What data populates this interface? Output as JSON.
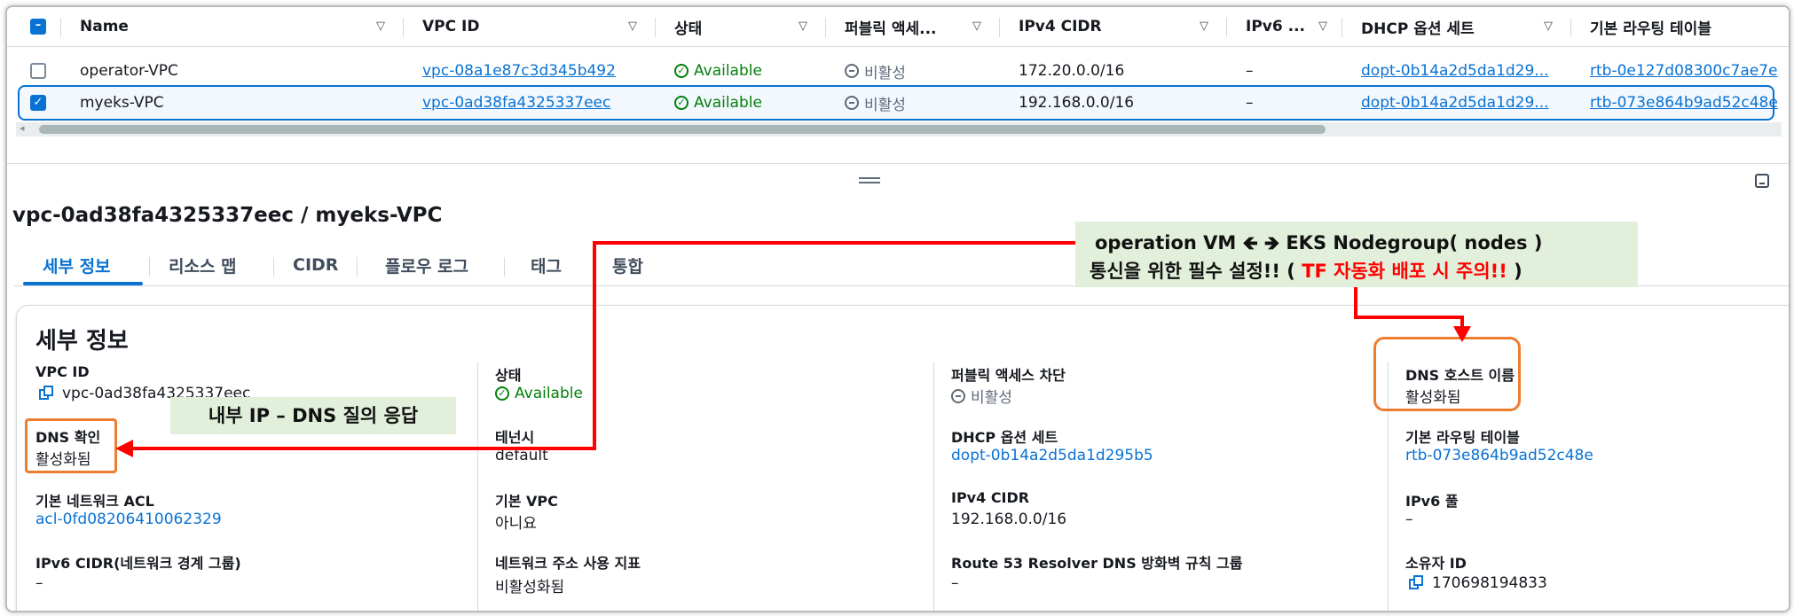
{
  "table": {
    "headers": [
      "Name",
      "VPC ID",
      "상태",
      "퍼블릭 액세...",
      "IPv4 CIDR",
      "IPv6 ...",
      "DHCP 옵션 세트",
      "기본 라우팅 테이블"
    ],
    "rows": [
      {
        "selected": false,
        "name": "operator-VPC",
        "vpc_id": "vpc-08a1e87c3d345b492",
        "status": "Available",
        "public": "비활성",
        "ipv4": "172.20.0.0/16",
        "ipv6": "–",
        "dhcp": "dopt-0b14a2d5da1d29...",
        "rtb": "rtb-0e127d08300c7ae7e"
      },
      {
        "selected": true,
        "name": "myeks-VPC",
        "vpc_id": "vpc-0ad38fa4325337eec",
        "status": "Available",
        "public": "비활성",
        "ipv4": "192.168.0.0/16",
        "ipv6": "–",
        "dhcp": "dopt-0b14a2d5da1d29...",
        "rtb": "rtb-073e864b9ad52c48e"
      }
    ]
  },
  "detail": {
    "title": "vpc-0ad38fa4325337eec / myeks-VPC",
    "tabs": [
      "세부 정보",
      "리소스 맵",
      "CIDR",
      "플로우 로그",
      "태그",
      "통합"
    ],
    "section_title": "세부 정보",
    "fields": {
      "vpc_id": {
        "label": "VPC ID",
        "value": "vpc-0ad38fa4325337eec"
      },
      "dns_resolution": {
        "label": "DNS 확인",
        "value": "활성화됨"
      },
      "main_acl": {
        "label": "기본 네트워크 ACL",
        "value": "acl-0fd08206410062329"
      },
      "ipv6_cidr": {
        "label": "IPv6 CIDR(네트워크 경계 그룹)",
        "value": "–"
      },
      "state": {
        "label": "상태",
        "value": "Available"
      },
      "tenancy": {
        "label": "테넌시",
        "value": "default"
      },
      "default_vpc": {
        "label": "기본 VPC",
        "value": "아니요"
      },
      "addr_metrics": {
        "label": "네트워크 주소 사용 지표",
        "value": "비활성화됨"
      },
      "block_public": {
        "label": "퍼블릭 액세스 차단",
        "value": "비활성"
      },
      "dhcp": {
        "label": "DHCP 옵션 세트",
        "value": "dopt-0b14a2d5da1d295b5"
      },
      "ipv4": {
        "label": "IPv4 CIDR",
        "value": "192.168.0.0/16"
      },
      "r53": {
        "label": "Route 53 Resolver DNS 방화벽 규칙 그룹",
        "value": "–"
      },
      "dns_hostnames": {
        "label": "DNS 호스트 이름",
        "value": "활성화됨"
      },
      "main_rtb": {
        "label": "기본 라우팅 테이블",
        "value": "rtb-073e864b9ad52c48e"
      },
      "ipv6_pool": {
        "label": "IPv6 풀",
        "value": "–"
      },
      "owner": {
        "label": "소유자 ID",
        "value": "170698194833"
      }
    }
  },
  "annotations": {
    "note1_line1": "operation VM 🡸 🡺 EKS Nodegroup( nodes )",
    "note1_line2_a": "통신을 위한 필수 설정!! ( ",
    "note1_line2_b": "TF 자동화 배포 시 주의!!",
    "note1_line2_c": " )",
    "note2": "내부 IP – DNS 질의 응답"
  },
  "colors": {
    "accent": "#0972d3",
    "success": "#037f0c",
    "annotation_red": "#ff0000",
    "highlight_box": "#ed7d31",
    "note_bg": "#e2efda"
  }
}
